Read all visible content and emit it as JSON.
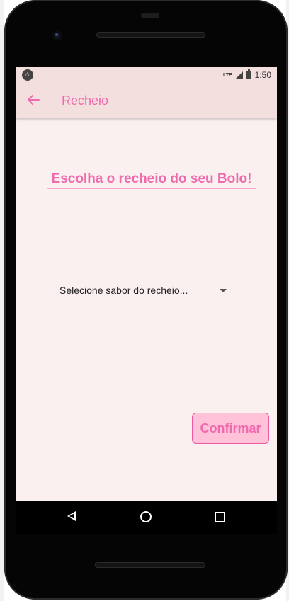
{
  "status_bar": {
    "app_icon": "android-icon",
    "network": "LTE",
    "time": "1:50"
  },
  "app_bar": {
    "back_icon": "arrow-left-icon",
    "title": "Recheio"
  },
  "main": {
    "heading": "Escolha o recheio do seu Bolo!",
    "dropdown": {
      "selected": "Selecione sabor do recheio...",
      "caret_icon": "caret-down-icon"
    },
    "confirm_label": "Confirmar"
  },
  "nav_bar": {
    "back_icon": "triangle-back-icon",
    "home_icon": "circle-home-icon",
    "recents_icon": "square-recents-icon"
  },
  "colors": {
    "accent": "#f06aae",
    "app_bar_bg": "#f4dfdf",
    "screen_bg": "#fbf0f0",
    "button_bg": "#ffc2d8",
    "button_border": "#ec5aa1"
  }
}
